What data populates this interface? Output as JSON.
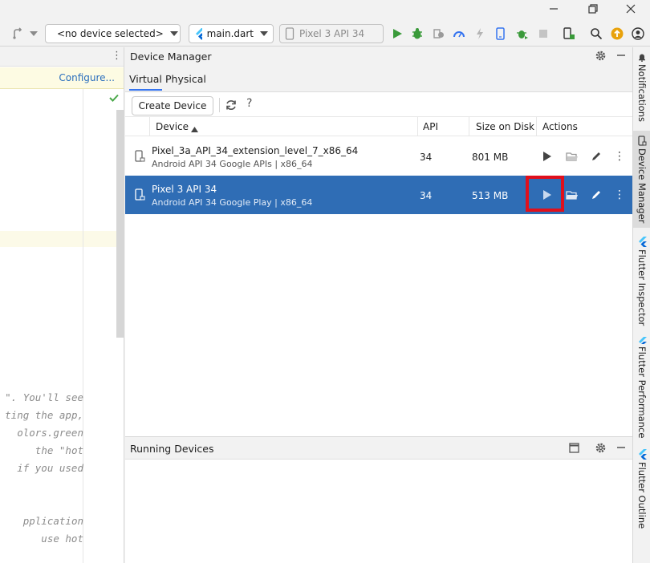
{
  "window": {
    "minimize_icon": "minimize-icon",
    "restore_icon": "restore-icon",
    "close_icon": "close-icon"
  },
  "toolbar": {
    "device_selector": "<no device selected>",
    "config_selector": "main.dart",
    "target_selector": "Pixel 3 API 34"
  },
  "editor": {
    "configure_link": "Configure...",
    "code_lines": [
      "\". You'll see",
      "ting the app,",
      "olors.green",
      " the \"hot",
      "if you used",
      "",
      "pplication",
      " use hot"
    ]
  },
  "device_manager": {
    "title": "Device Manager",
    "tabs": [
      {
        "label": "Virtual",
        "active": true
      },
      {
        "label": "Physical",
        "active": false
      }
    ],
    "create_device_label": "Create Device",
    "help_symbol": "?",
    "columns": {
      "device": "Device",
      "api": "API",
      "size": "Size on Disk",
      "actions": "Actions"
    },
    "devices": [
      {
        "name": "Pixel_3a_API_34_extension_level_7_x86_64",
        "details": "Android API 34 Google APIs | x86_64",
        "api": "34",
        "size": "801 MB",
        "selected": false
      },
      {
        "name": "Pixel 3 API 34",
        "details": "Android API 34 Google Play | x86_64",
        "api": "34",
        "size": "513 MB",
        "selected": true
      }
    ]
  },
  "running_devices": {
    "title": "Running Devices"
  },
  "right_strip": {
    "tabs": [
      {
        "label": "Notifications",
        "active": false
      },
      {
        "label": "Device Manager",
        "active": true
      },
      {
        "label": "Flutter Inspector",
        "active": false
      },
      {
        "label": "Flutter Performance",
        "active": false
      },
      {
        "label": "Flutter Outline",
        "active": false
      }
    ]
  },
  "colors": {
    "selection": "#2f6db5",
    "accent": "#3574f0",
    "highlight_box": "#e0101c",
    "run_green": "#3a9a3a"
  }
}
